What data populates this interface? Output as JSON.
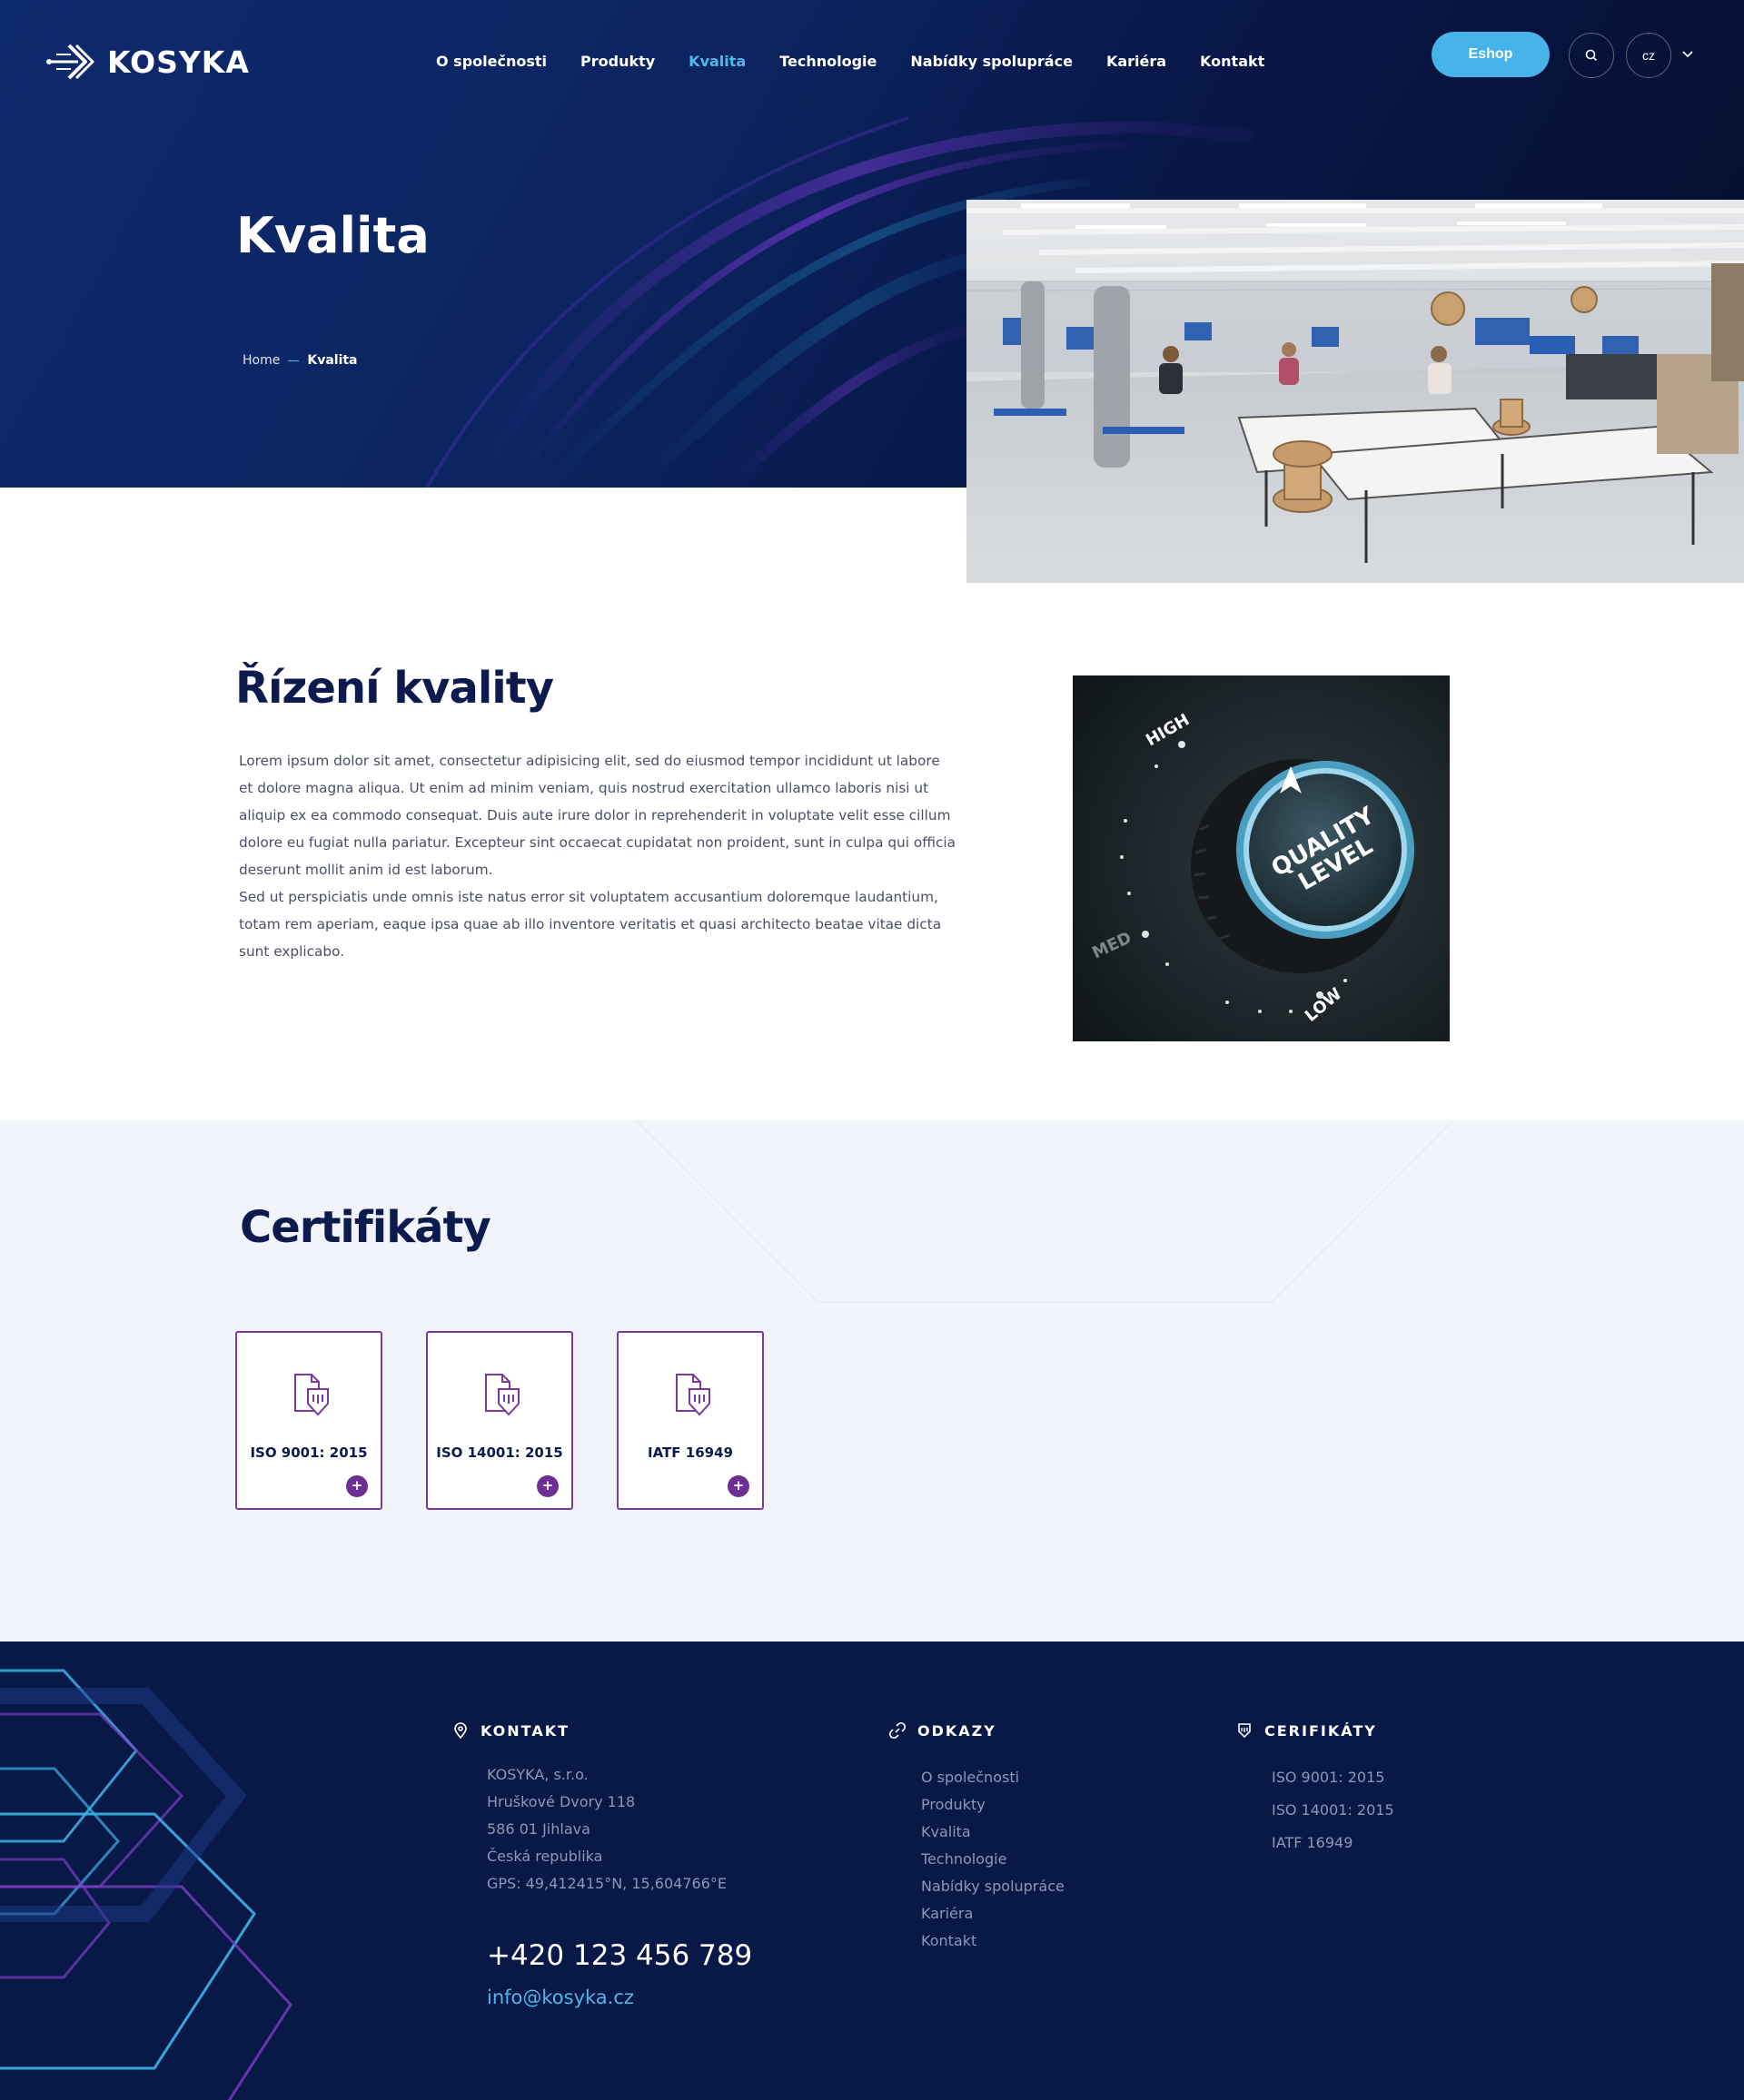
{
  "header": {
    "logo_text": "KOSYKA",
    "nav": [
      {
        "label": "O společnosti",
        "active": false
      },
      {
        "label": "Produkty",
        "active": false
      },
      {
        "label": "Kvalita",
        "active": true
      },
      {
        "label": "Technologie",
        "active": false
      },
      {
        "label": "Nabídky spolupráce",
        "active": false
      },
      {
        "label": "Kariéra",
        "active": false
      },
      {
        "label": "Kontakt",
        "active": false
      }
    ],
    "eshop_label": "Eshop",
    "lang_label": "cz"
  },
  "hero": {
    "title": "Kvalita",
    "breadcrumb": {
      "home": "Home",
      "current": "Kvalita"
    }
  },
  "quality": {
    "title": "Řízení kvality",
    "paragraph1": "Lorem ipsum dolor sit amet, consectetur adipisicing elit, sed do eiusmod tempor incididunt ut labore et dolore magna aliqua. Ut enim ad minim veniam, quis nostrud exercitation ullamco laboris nisi ut aliquip ex ea commodo consequat. Duis aute irure dolor in reprehenderit in voluptate velit esse cillum dolore eu fugiat nulla pariatur. Excepteur sint occaecat cupidatat non proident, sunt in culpa qui officia deserunt mollit anim id est laborum.",
    "paragraph2": "Sed ut perspiciatis unde omnis iste natus error sit voluptatem accusantium doloremque laudantium, totam rem aperiam, eaque ipsa quae ab illo inventore veritatis et quasi architecto beatae vitae dicta sunt explicabo.",
    "knob": {
      "high": "HIGH",
      "med": "MED",
      "low": "LOW",
      "line1": "QUALITY",
      "line2": "LEVEL"
    }
  },
  "certificates": {
    "title": "Certifikáty",
    "items": [
      {
        "label": "ISO 9001: 2015",
        "icon": "document-icon",
        "action": "+"
      },
      {
        "label": "ISO 14001: 2015",
        "icon": "document-icon",
        "action": "+"
      },
      {
        "label": "IATF 16949",
        "icon": "document-icon",
        "action": "+"
      }
    ]
  },
  "footer": {
    "contact": {
      "heading": "KONTAKT",
      "lines": [
        "KOSYKA, s.r.o.",
        "Hruškové Dvory 118",
        "586 01 Jihlava",
        "Česká republika",
        "GPS: 49,412415°N, 15,604766°E"
      ],
      "phone": "+420 123 456 789",
      "email": "info@kosyka.cz"
    },
    "links": {
      "heading": "ODKAZY",
      "items": [
        "O společnosti",
        "Produkty",
        "Kvalita",
        "Technologie",
        "Nabídky spolupráce",
        "Kariéra",
        "Kontakt"
      ]
    },
    "certs": {
      "heading": "CERIFIKÁTY",
      "items": [
        "ISO 9001: 2015",
        "ISO 14001: 2015",
        "IATF 16949"
      ]
    }
  },
  "colors": {
    "accent_blue": "#46b4e8",
    "navy": "#081947",
    "purple": "#7c3aa0",
    "section_bg": "#f1f4fb"
  }
}
